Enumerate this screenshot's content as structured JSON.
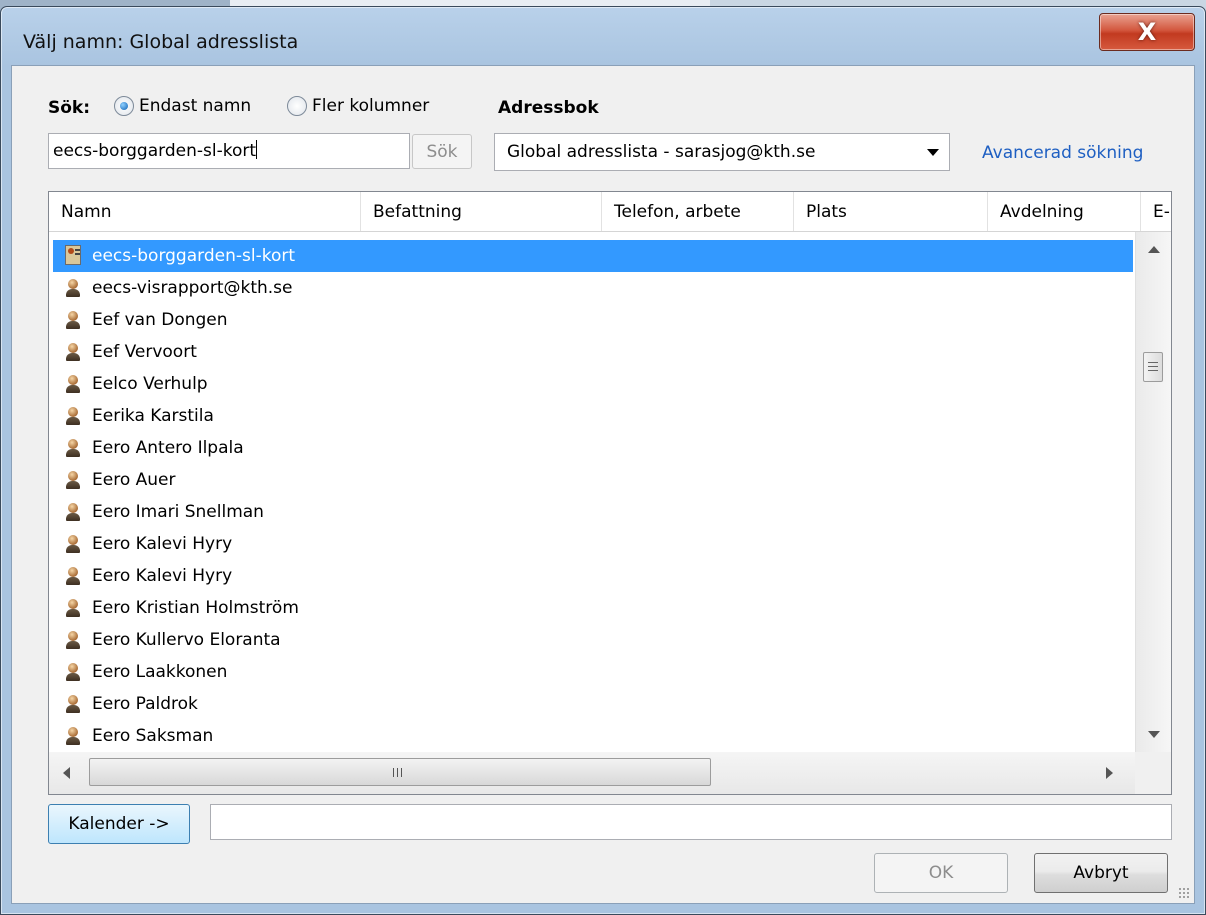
{
  "window": {
    "title": "Välj namn: Global adresslista",
    "close_label": "X"
  },
  "search": {
    "label": "Sök:",
    "radio_name_only": "Endast namn",
    "radio_more_columns": "Fler kolumner",
    "selected_radio": "Endast namn",
    "query": "eecs-borggarden-sl-kort",
    "button": "Sök"
  },
  "addressbook": {
    "label": "Adressbok",
    "selected": "Global adresslista - sarasjog@kth.se",
    "advanced_link": "Avancerad sökning"
  },
  "columns": [
    "Namn",
    "Befattning",
    "Telefon, arbete",
    "Plats",
    "Avdelning",
    "E-"
  ],
  "rows": [
    {
      "name": "eecs-borggarden-sl-kort",
      "icon": "distribution-list-icon",
      "selected": true
    },
    {
      "name": "eecs-visrapport@kth.se",
      "icon": "person-icon"
    },
    {
      "name": "Eef van Dongen",
      "icon": "person-icon"
    },
    {
      "name": "Eef Vervoort",
      "icon": "person-icon"
    },
    {
      "name": "Eelco Verhulp",
      "icon": "person-icon"
    },
    {
      "name": "Eerika Karstila",
      "icon": "person-icon"
    },
    {
      "name": "Eero Antero Ilpala",
      "icon": "person-icon"
    },
    {
      "name": "Eero Auer",
      "icon": "person-icon"
    },
    {
      "name": "Eero Imari Snellman",
      "icon": "person-icon"
    },
    {
      "name": "Eero Kalevi Hyry",
      "icon": "person-icon"
    },
    {
      "name": "Eero Kalevi Hyry",
      "icon": "person-icon"
    },
    {
      "name": "Eero Kristian Holmström",
      "icon": "person-icon"
    },
    {
      "name": "Eero Kullervo Eloranta",
      "icon": "person-icon"
    },
    {
      "name": "Eero Laakkonen",
      "icon": "person-icon"
    },
    {
      "name": "Eero Paldrok",
      "icon": "person-icon"
    },
    {
      "name": "Eero Saksman",
      "icon": "person-icon"
    }
  ],
  "footer": {
    "calendar_button": "Kalender ->",
    "calendar_value": "",
    "ok_button": "OK",
    "cancel_button": "Avbryt"
  },
  "colors": {
    "selection": "#3399ff",
    "link": "#1e5fc2",
    "close_button": "#c23a20"
  }
}
